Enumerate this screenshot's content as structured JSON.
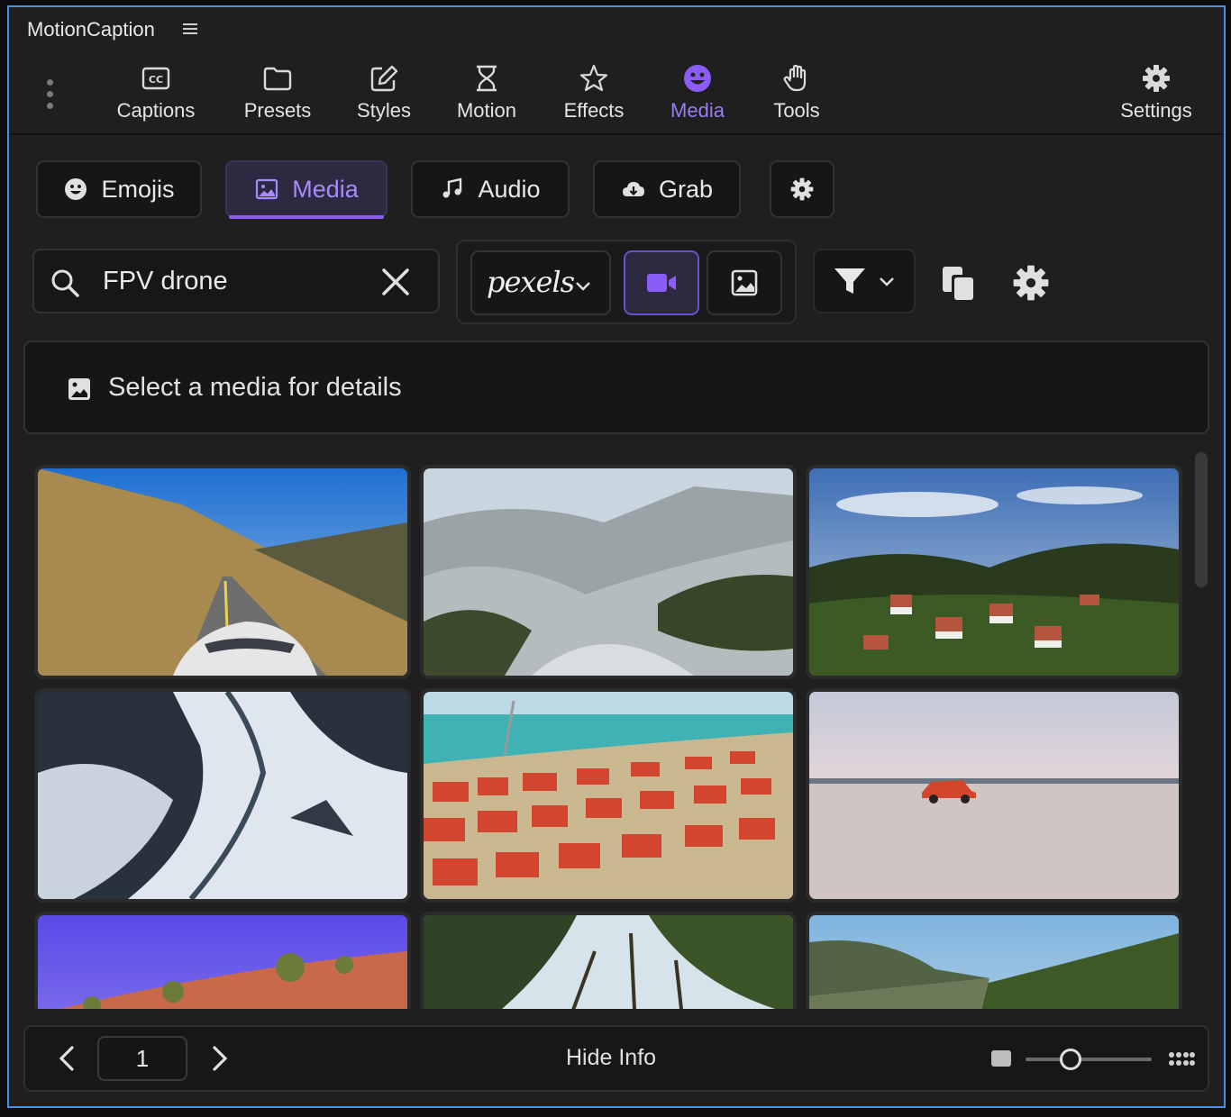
{
  "app": {
    "title": "MotionCaption"
  },
  "nav": {
    "items": [
      {
        "label": "Captions",
        "icon": "closed-captions-icon"
      },
      {
        "label": "Presets",
        "icon": "folder-icon"
      },
      {
        "label": "Styles",
        "icon": "pencil-square-icon"
      },
      {
        "label": "Motion",
        "icon": "hourglass-icon"
      },
      {
        "label": "Effects",
        "icon": "star-icon"
      },
      {
        "label": "Media",
        "icon": "smiley-icon",
        "active": true
      },
      {
        "label": "Tools",
        "icon": "hand-icon"
      }
    ],
    "settings_label": "Settings",
    "accent": "#9c7cf4"
  },
  "subtabs": {
    "emojis": "Emojis",
    "media": "Media",
    "audio": "Audio",
    "grab": "Grab",
    "active": "Media"
  },
  "search": {
    "value": "FPV drone",
    "placeholder": ""
  },
  "source": {
    "brand": "pexels",
    "type_selected": "video"
  },
  "details": {
    "text": "Select a media for details"
  },
  "grid": {
    "thumbnails": [
      "mountain-road-car",
      "snowy-rocky-mountains",
      "hillside-village",
      "snowy-valley-river",
      "coastal-town-red-roofs",
      "red-truck-on-salt-flat",
      "desert-dirt-trail",
      "forest-canopy",
      "green-hills-valley"
    ]
  },
  "footer": {
    "page": "1",
    "hide_info_label": "Hide Info",
    "thumbnail_size": 0.35
  }
}
